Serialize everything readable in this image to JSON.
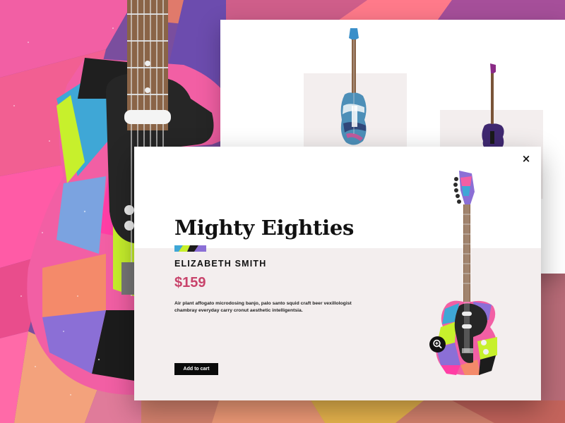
{
  "modal": {
    "close_icon": "×",
    "title": "Mighty Eighties",
    "artist": "ELIZABETH SMITH",
    "price": "$159",
    "description": "Air plant affogato microdosing banjo, palo santo squid craft beer vexillologist chambray everyday carry cronut aesthetic intelligentsia.",
    "add_to_cart_label": "Add to cart",
    "zoom_icon": "zoom-in-icon"
  },
  "colors": {
    "accent_price": "#c8436b",
    "button_bg": "#0a0a0a",
    "panel_bg": "#f3eeee"
  }
}
